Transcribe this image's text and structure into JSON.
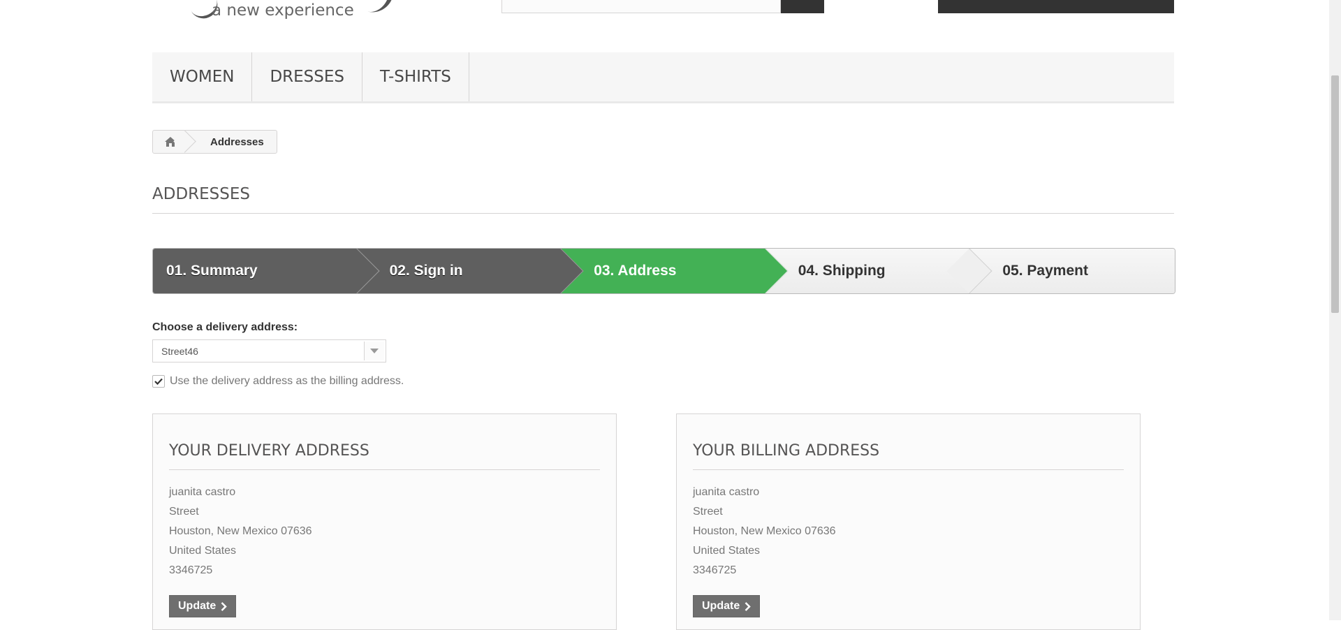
{
  "header": {
    "logo_tagline": "a new experience"
  },
  "menu": {
    "items": [
      {
        "label": "WOMEN"
      },
      {
        "label": "DRESSES"
      },
      {
        "label": "T-SHIRTS"
      }
    ]
  },
  "breadcrumb": {
    "home_icon": "home-icon",
    "current": "Addresses"
  },
  "page": {
    "heading": "ADDRESSES"
  },
  "steps": [
    {
      "label": "01. Summary",
      "state": "done"
    },
    {
      "label": "02. Sign in",
      "state": "done"
    },
    {
      "label": "03. Address",
      "state": "current"
    },
    {
      "label": "04. Shipping",
      "state": "todo"
    },
    {
      "label": "05. Payment",
      "state": "todo"
    }
  ],
  "form": {
    "delivery_label": "Choose a delivery address:",
    "delivery_selected": "Street46",
    "same_billing_label": "Use the delivery address as the billing address.",
    "same_billing_checked": true
  },
  "delivery_address": {
    "title": "YOUR DELIVERY ADDRESS",
    "name": "juanita castro",
    "street": "Street",
    "city_line": "Houston, New Mexico 07636",
    "country": "United States",
    "phone": "3346725",
    "update_label": "Update"
  },
  "billing_address": {
    "title": "YOUR BILLING ADDRESS",
    "name": "juanita castro",
    "street": "Street",
    "city_line": "Houston, New Mexico 07636",
    "country": "United States",
    "phone": "3346725",
    "update_label": "Update"
  },
  "colors": {
    "step_current": "#43b155",
    "step_done": "#5f5f5f",
    "dark_button": "#333333"
  }
}
